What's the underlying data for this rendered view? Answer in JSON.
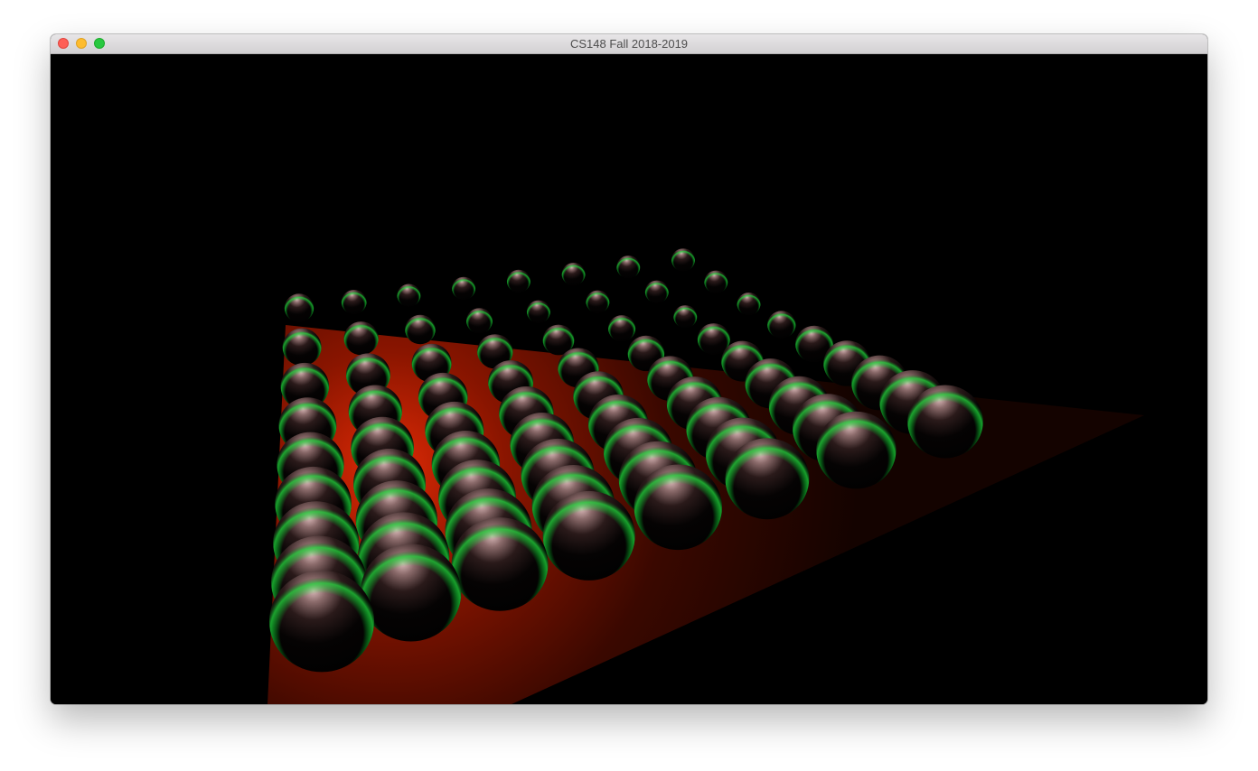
{
  "window": {
    "title": "CS148 Fall 2018-2019",
    "controls": [
      "close-button",
      "minimize-button",
      "zoom-button"
    ]
  },
  "scene": {
    "background": "#000000",
    "plane_color": "#c81e00",
    "sphere_specular": "#e8c8c8",
    "sphere_rim": "#22dd33"
  },
  "colors": {
    "close": "#fe5f57",
    "minimize": "#febc2e",
    "zoom": "#28c840"
  }
}
